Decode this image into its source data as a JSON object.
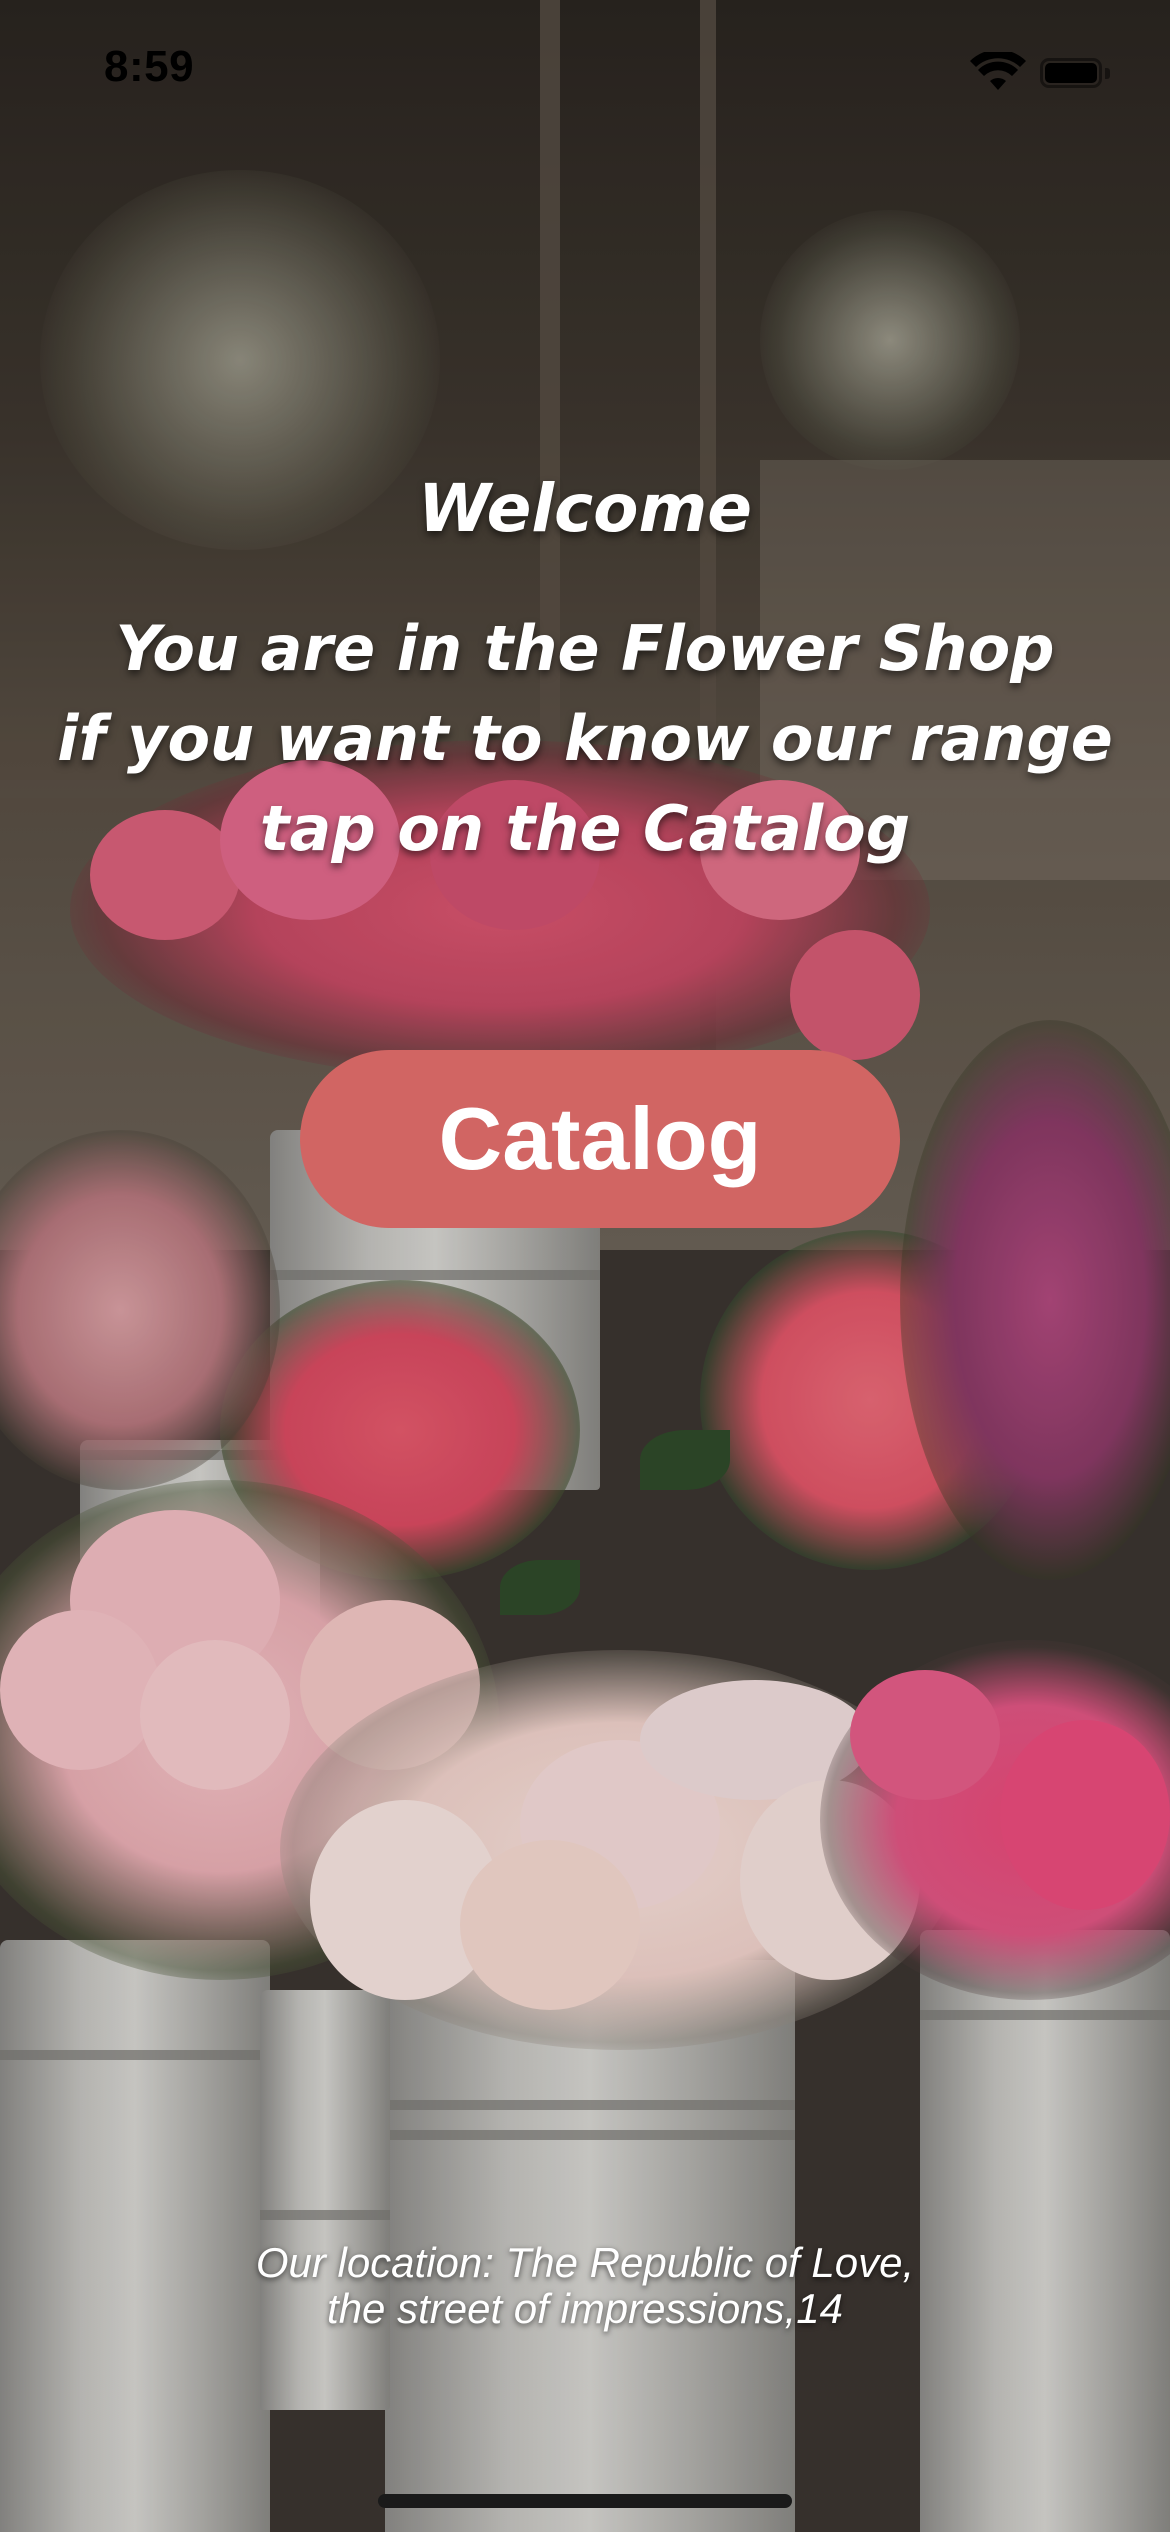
{
  "status_bar": {
    "time": "8:59",
    "wifi_icon": "wifi-icon",
    "battery_icon": "battery-full-icon"
  },
  "main": {
    "welcome_title": "Welcome",
    "intro_lines": [
      "You are in the Flower Shop",
      "if you want to know our range",
      "tap on the Catalog"
    ],
    "catalog_button_label": "Catalog",
    "location_lines": [
      "Our location: The Republic of Love,",
      "the street of impressions,14"
    ]
  },
  "colors": {
    "button_background": "#d16563",
    "text": "#ffffff"
  }
}
